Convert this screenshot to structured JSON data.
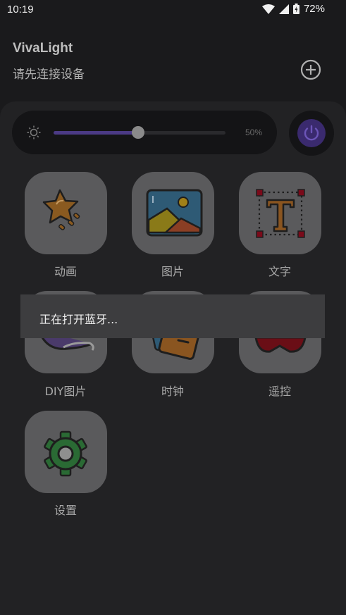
{
  "status_bar": {
    "time": "10:19",
    "battery": "72%"
  },
  "header": {
    "title": "VivaLight",
    "subtitle": "请先连接设备"
  },
  "brightness": {
    "value_percent": 50,
    "label": "50%"
  },
  "tiles": [
    {
      "label": "动画",
      "icon": "star-animation-icon"
    },
    {
      "label": "图片",
      "icon": "picture-icon"
    },
    {
      "label": "文字",
      "icon": "text-t-icon"
    },
    {
      "label": "DIY图片",
      "icon": "diy-brush-icon"
    },
    {
      "label": "时钟",
      "icon": "clock-card-icon"
    },
    {
      "label": "遥控",
      "icon": "gamepad-icon"
    },
    {
      "label": "设置",
      "icon": "gear-icon"
    }
  ],
  "toast": {
    "message": "正在打开蓝牙..."
  }
}
